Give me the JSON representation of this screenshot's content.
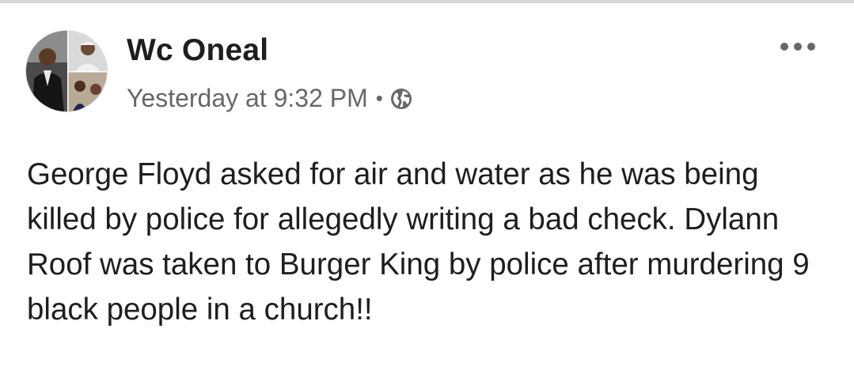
{
  "post": {
    "author": "Wc Oneal",
    "timestamp": "Yesterday at 9:32 PM",
    "separator": "•",
    "privacy_icon": "globe-icon",
    "more_icon": "more-horizontal-icon",
    "text": "George Floyd asked for air and water as he was being killed by police for allegedly writing a bad check. Dylann Roof was taken to Burger King by police after murdering 9 black people in a church!!"
  },
  "colors": {
    "name": "#1c1e21",
    "meta": "#65676b",
    "body_text": "#1c1e21",
    "border": "#d4d6da",
    "background": "#ffffff"
  }
}
